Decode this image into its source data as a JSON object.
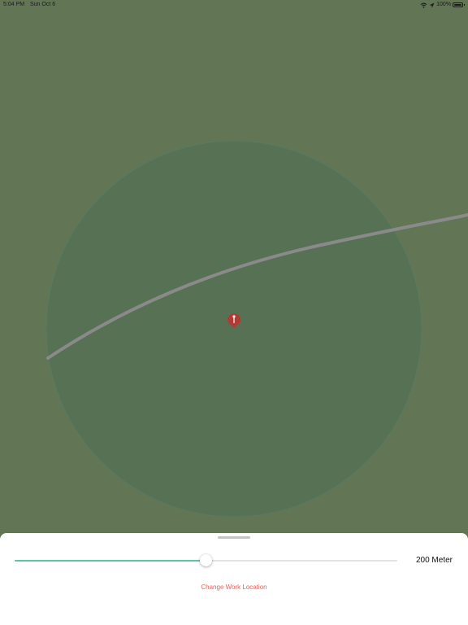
{
  "status_bar": {
    "time": "5:04 PM",
    "date": "Sun Oct 6",
    "battery": "100%",
    "icons": [
      "wifi-icon",
      "location-arrow-icon",
      "battery-icon"
    ]
  },
  "map": {
    "icons": [
      "location-pin-icon"
    ],
    "colors": {
      "terrain": "#627555",
      "radius_fill": "#4f6d55",
      "road": "#8a8a8a",
      "pin": "#b33a32"
    }
  },
  "radius_control": {
    "value_fraction": 0.5,
    "distance_label": "200 Meter",
    "track_fill_color": "#5cc6a2"
  },
  "actions": {
    "change_location_label": "Change Work Location",
    "change_location_color": "#e4635c"
  }
}
